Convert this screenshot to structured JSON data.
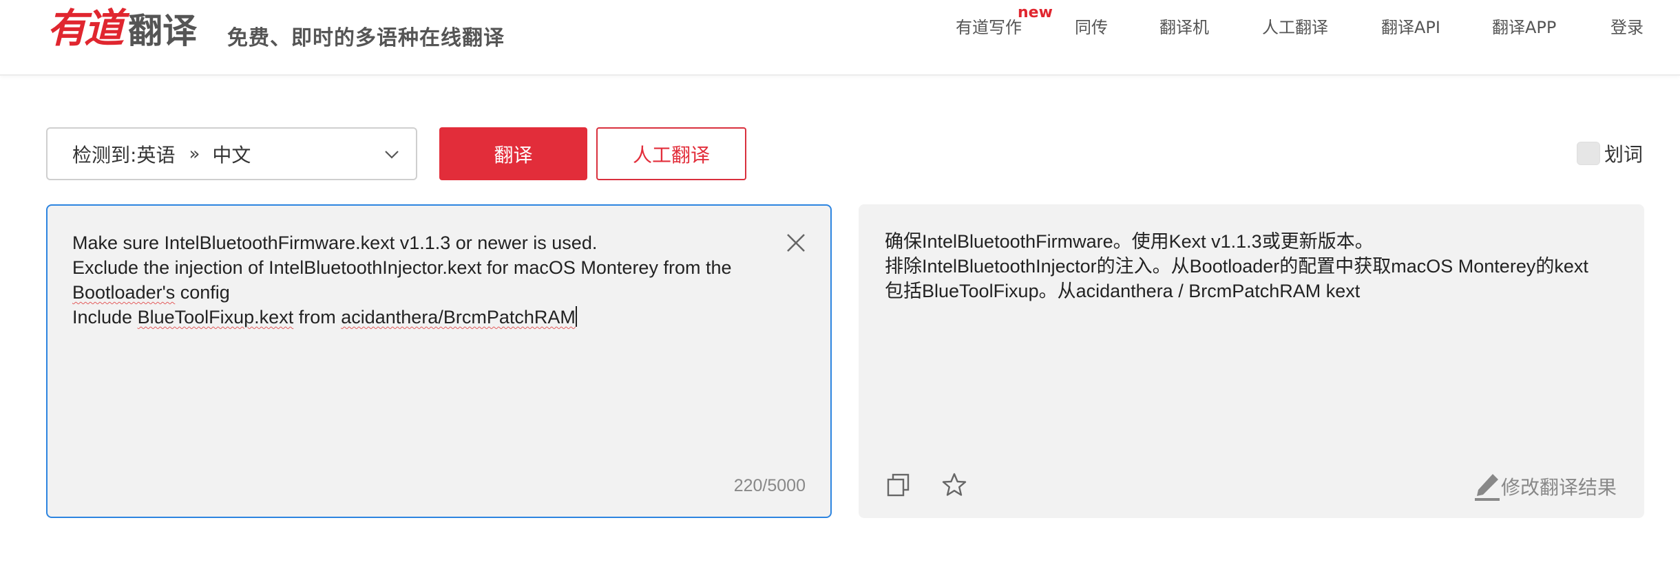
{
  "header": {
    "logo_youdao": "有道",
    "logo_fanyi": "翻译",
    "tagline": "免费、即时的多语种在线翻译",
    "nav": [
      {
        "label": "有道写作",
        "badge": "new"
      },
      {
        "label": "同传"
      },
      {
        "label": "翻译机"
      },
      {
        "label": "人工翻译"
      },
      {
        "label": "翻译API"
      },
      {
        "label": "翻译APP"
      },
      {
        "label": "登录"
      }
    ]
  },
  "toolbar": {
    "lang_detected_prefix": "检测到:",
    "source_lang": "英语",
    "separator": "»",
    "target_lang": "中文",
    "translate_label": "翻译",
    "human_translate_label": "人工翻译",
    "word_select_label": "划词"
  },
  "source": {
    "line1": "Make sure IntelBluetoothFirmware.kext v1.1.3 or newer is used.",
    "line2": "Exclude the injection of IntelBluetoothInjector.kext for macOS Monterey from the",
    "line3_a": "Bootloader's",
    "line3_b": " config",
    "line4_a": "Include ",
    "line4_b": "BlueToolFixup.kext",
    "line4_c": " from ",
    "line4_d": "acidanthera/BrcmPatchRAM",
    "char_count": "220/5000"
  },
  "result": {
    "line1": "确保IntelBluetoothFirmware。使用Kext v1.1.3或更新版本。",
    "line2": "排除IntelBluetoothInjector的注入。从Bootloader的配置中获取macOS Monterey的kext",
    "line3": "包括BlueToolFixup。从acidanthera / BrcmPatchRAM kext",
    "edit_label": "修改翻译结果"
  },
  "colors": {
    "brand_red": "#e22d3a",
    "focus_blue": "#2c84e0",
    "panel_bg": "#f2f2f2"
  },
  "icons": {
    "clear": "close-icon",
    "copy": "copy-icon",
    "favorite": "star-icon",
    "edit": "pencil-icon",
    "dropdown": "chevron-down-icon"
  }
}
